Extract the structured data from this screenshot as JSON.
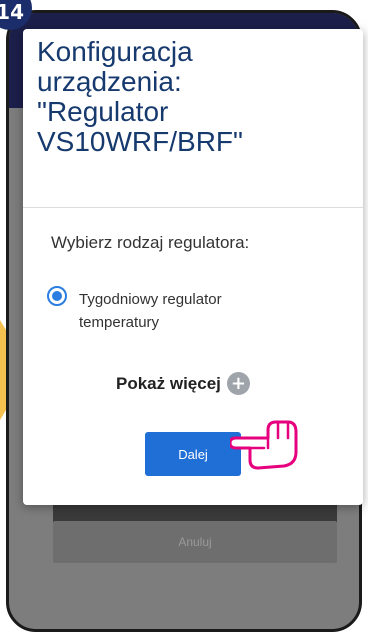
{
  "step": {
    "number": "14"
  },
  "dialog": {
    "title": "Konfiguracja\nurządzenia:\n\"Regulator\nVS10WRF/BRF\"",
    "subtitle": "Wybierz rodzaj regulatora:",
    "option_label": "Tygodniowy regulator temperatury",
    "option_selected": true,
    "show_more_label": "Pokaż więcej",
    "show_more_icon": "plus-circle-icon",
    "next_label": "Dalej"
  },
  "background": {
    "cancel_label": "Anuluj"
  },
  "colors": {
    "title": "#173a6e",
    "accent": "#1f6fd6",
    "badge": "#1b2e6b",
    "arrow": "#f4c14f",
    "pointer": "#e6007e"
  },
  "pointer_icon": "pointing-hand-icon"
}
